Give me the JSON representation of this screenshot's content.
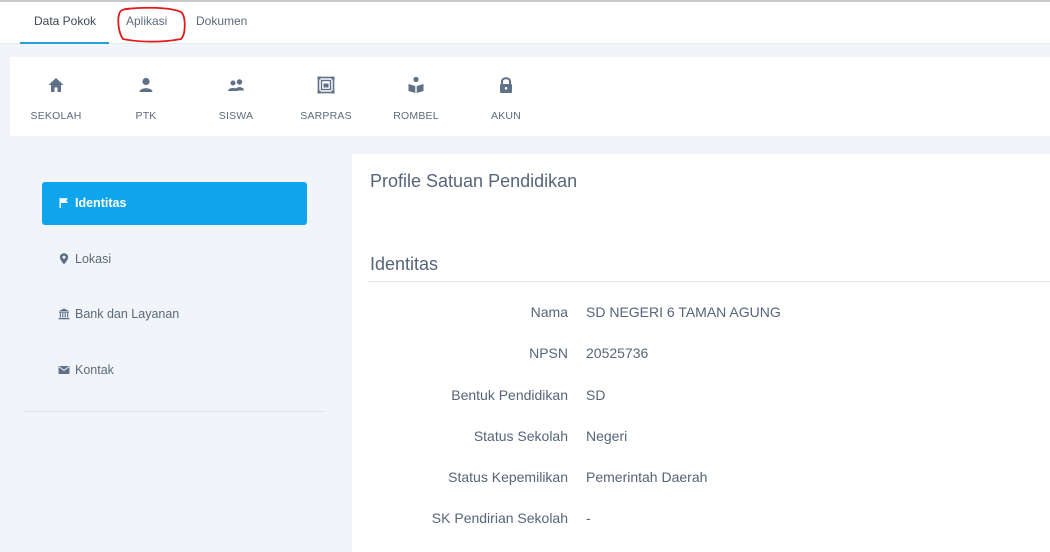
{
  "tabs": [
    {
      "label": "Data Pokok",
      "active": true
    },
    {
      "label": "Aplikasi",
      "active": false
    },
    {
      "label": "Dokumen",
      "active": false
    }
  ],
  "modules": [
    {
      "label": "SEKOLAH",
      "icon": "home-icon"
    },
    {
      "label": "PTK",
      "icon": "user-icon"
    },
    {
      "label": "SISWA",
      "icon": "users-icon"
    },
    {
      "label": "SARPRAS",
      "icon": "building-frame-icon"
    },
    {
      "label": "ROMBEL",
      "icon": "reading-icon"
    },
    {
      "label": "AKUN",
      "icon": "lock-icon"
    }
  ],
  "sidebar": {
    "items": [
      {
        "label": "Identitas",
        "icon": "flag-icon",
        "active": true
      },
      {
        "label": "Lokasi",
        "icon": "map-pin-icon",
        "active": false
      },
      {
        "label": "Bank dan Layanan",
        "icon": "bank-icon",
        "active": false
      },
      {
        "label": "Kontak",
        "icon": "envelope-icon",
        "active": false
      }
    ]
  },
  "main": {
    "title": "Profile Satuan Pendidikan",
    "section_title": "Identitas",
    "fields": [
      {
        "label": "Nama",
        "value": "SD NEGERI 6 TAMAN AGUNG"
      },
      {
        "label": "NPSN",
        "value": "20525736"
      },
      {
        "label": "Bentuk Pendidikan",
        "value": "SD"
      },
      {
        "label": "Status Sekolah",
        "value": "Negeri"
      },
      {
        "label": "Status Kepemilikan",
        "value": "Pemerintah Daerah"
      },
      {
        "label": "SK Pendirian Sekolah",
        "value": "-"
      }
    ]
  },
  "colors": {
    "accent": "#0ea5ec",
    "tab_underline": "#2a9fd6",
    "annotation": "#e01b1b",
    "icon": "#5f7186",
    "background": "#f1f4f8"
  }
}
